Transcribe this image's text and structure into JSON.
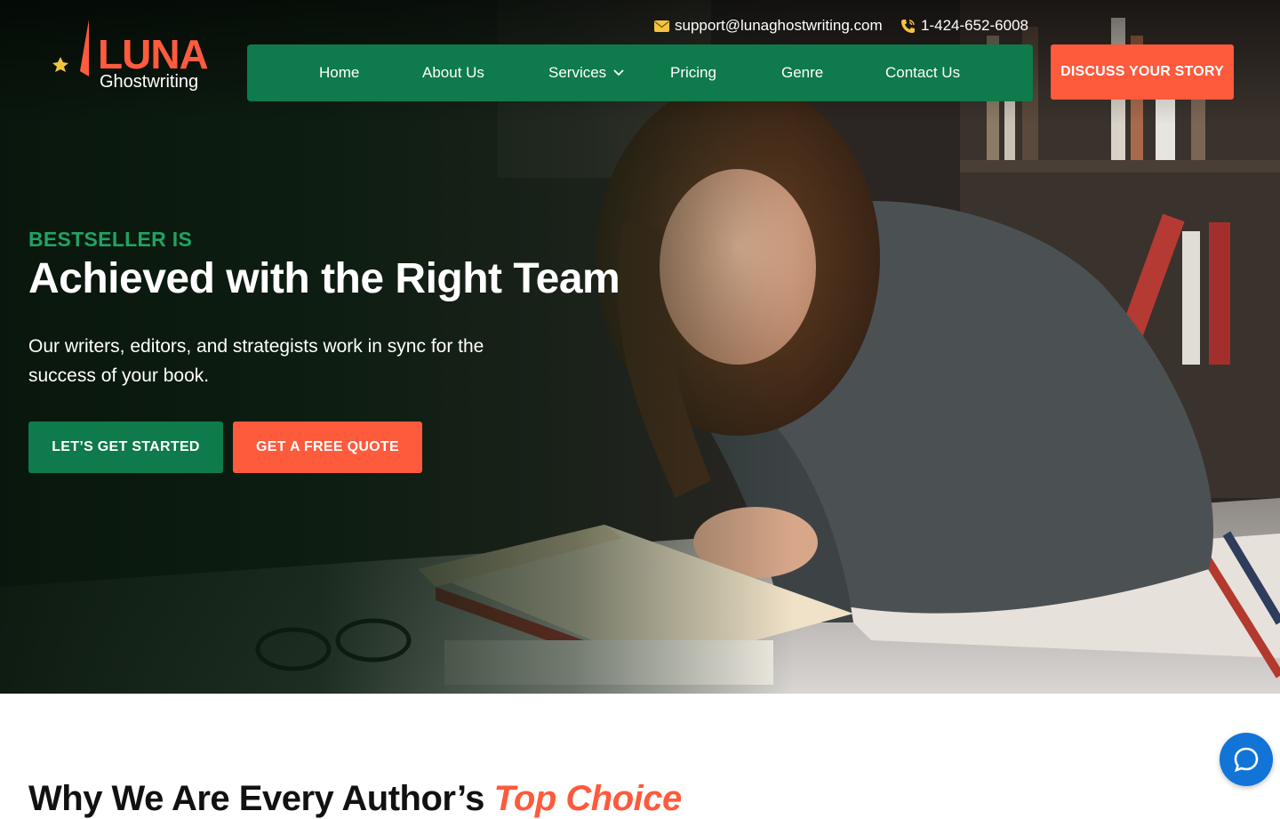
{
  "brand": {
    "name": "LUNA",
    "tagline": "Ghostwriting",
    "logo_icon": "moon-star-logo"
  },
  "topbar": {
    "email": "support@lunaghostwriting.com",
    "email_icon": "envelope-icon",
    "phone": "1-424-652-6008",
    "phone_icon": "phone-icon"
  },
  "nav": {
    "items": [
      {
        "label": "Home"
      },
      {
        "label": "About Us"
      },
      {
        "label": "Services",
        "has_dropdown": true
      },
      {
        "label": "Pricing"
      },
      {
        "label": "Genre"
      },
      {
        "label": "Contact Us"
      }
    ],
    "cta_label": "DISCUSS YOUR STORY"
  },
  "hero": {
    "eyebrow": "BESTSELLER IS",
    "headline": "Achieved with the Right Team",
    "subtext": "Our writers, editors, and strategists work in sync for the success of your book.",
    "primary_button": "LET’S GET STARTED",
    "secondary_button": "GET A FREE QUOTE",
    "image": "woman-reading-book-photo"
  },
  "section": {
    "title_prefix": "Why We Are Every Author’s",
    "title_accent": "Top Choice"
  },
  "chat_widget": {
    "icon": "chat-bubble-icon"
  },
  "colors": {
    "brand_green": "#0f7a4b",
    "accent_orange": "#fe5a3c",
    "eyebrow_green": "#1fa365",
    "chat_blue": "#1274d6"
  }
}
